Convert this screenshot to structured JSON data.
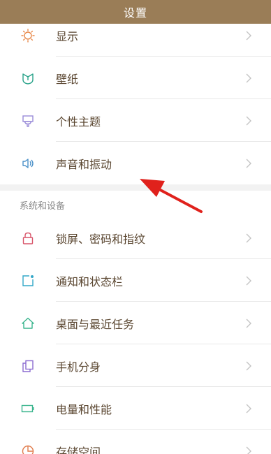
{
  "header": {
    "title": "设置"
  },
  "group1": {
    "items": [
      {
        "label": "显示",
        "icon": "sun-icon"
      },
      {
        "label": "壁纸",
        "icon": "wallpaper-icon"
      },
      {
        "label": "个性主题",
        "icon": "theme-brush-icon"
      },
      {
        "label": "声音和振动",
        "icon": "speaker-icon"
      }
    ]
  },
  "group2": {
    "header": "系统和设备",
    "items": [
      {
        "label": "锁屏、密码和指纹",
        "icon": "lock-icon"
      },
      {
        "label": "通知和状态栏",
        "icon": "notification-icon"
      },
      {
        "label": "桌面与最近任务",
        "icon": "home-icon"
      },
      {
        "label": "手机分身",
        "icon": "dual-phone-icon"
      },
      {
        "label": "电量和性能",
        "icon": "battery-icon"
      },
      {
        "label": "存储空间",
        "icon": "storage-icon"
      }
    ]
  },
  "colors": {
    "title_bar": "#9a7d57",
    "annotation_arrow": "#e0211c",
    "icon_orange": "#e8894a",
    "icon_teal": "#2aa38a",
    "icon_purple": "#9a8cd8",
    "icon_blue": "#4a90c8",
    "icon_pink": "#d8556a",
    "icon_cyan": "#34a8c8",
    "icon_green": "#3bb58e",
    "icon_violet": "#8c6cd0",
    "icon_orange2": "#e07a4a"
  }
}
